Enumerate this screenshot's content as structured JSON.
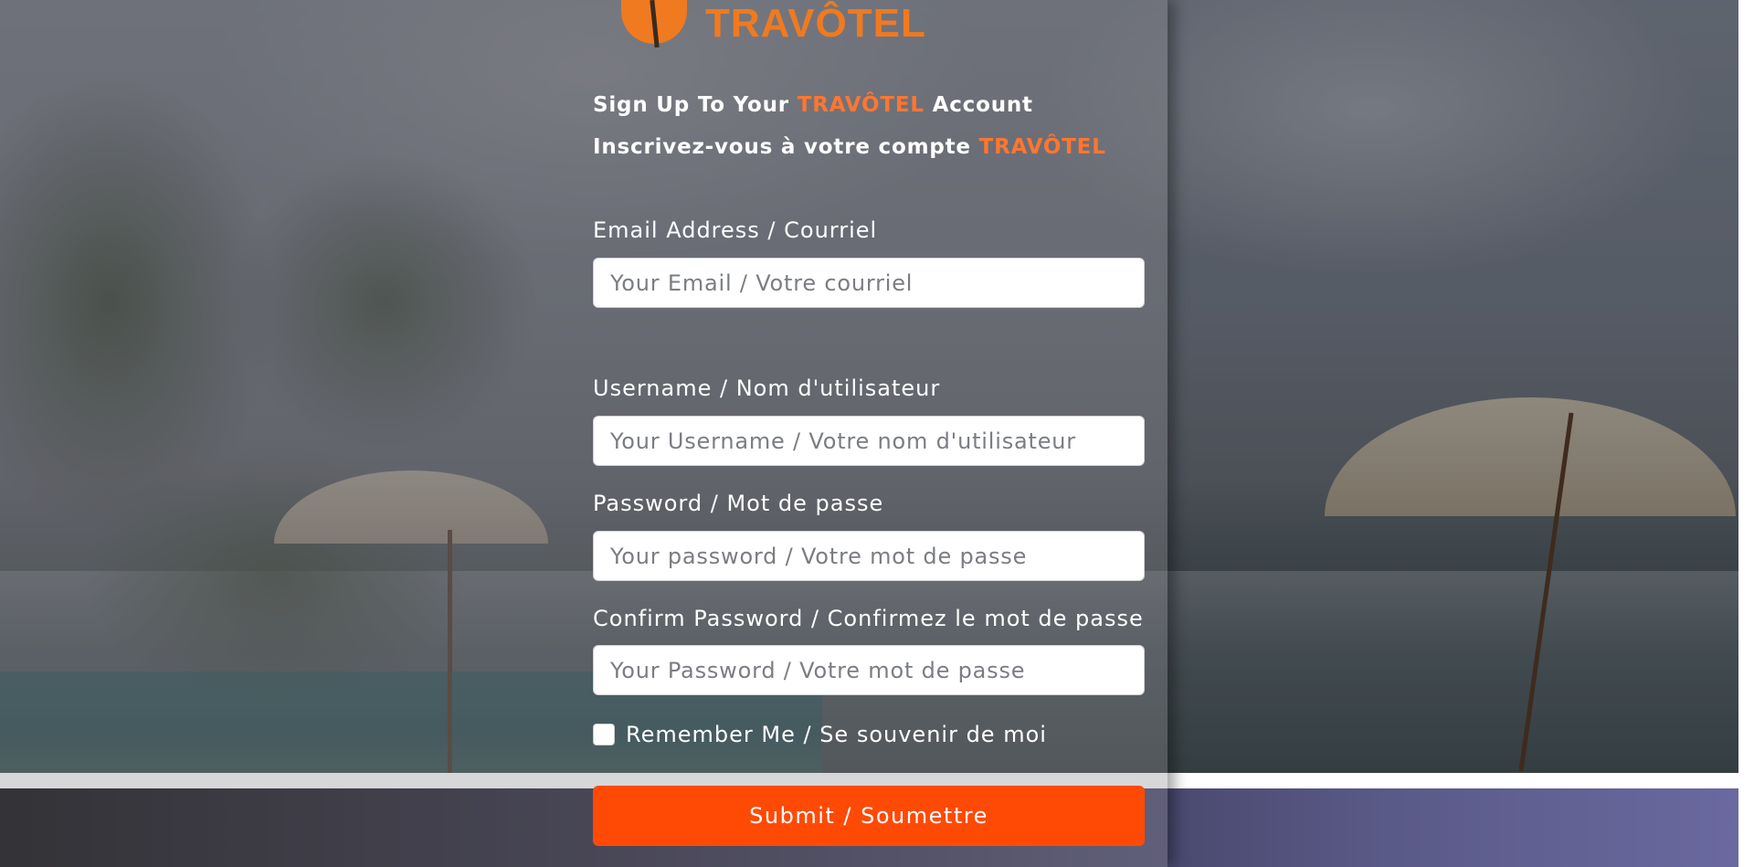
{
  "logo": {
    "text": "TRAVÔTEL"
  },
  "heading_en": {
    "prefix": "Sign Up To Your ",
    "brand": "TRAVÔTEL",
    "suffix": " Account"
  },
  "heading_fr": {
    "prefix": "Inscrivez-vous à votre compte ",
    "brand": "TRAVÔTEL"
  },
  "form": {
    "email": {
      "label": "Email Address / Courriel",
      "placeholder": "Your Email / Votre courriel"
    },
    "username": {
      "label": "Username / Nom d'utilisateur",
      "placeholder": "Your Username / Votre nom d'utilisateur"
    },
    "password": {
      "label": "Password / Mot de passe",
      "placeholder": "Your password / Votre mot de passe"
    },
    "confirm_password": {
      "label": "Confirm Password / Confirmez le mot de passe",
      "placeholder": "Your Password / Votre mot de passe"
    },
    "remember": {
      "label": "Remember Me / Se souvenir de moi",
      "checked": false
    },
    "submit_label": "Submit / Soumettre"
  },
  "colors": {
    "brand_orange": "#ff7630",
    "submit_bg": "#ff4a05"
  }
}
